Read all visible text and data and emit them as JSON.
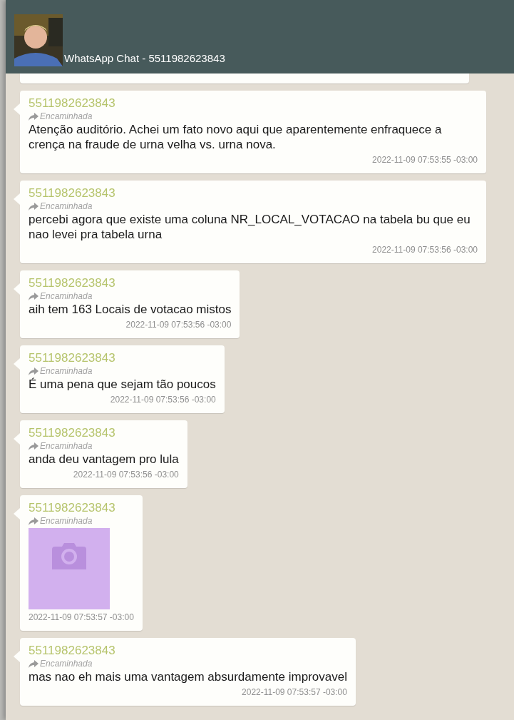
{
  "header": {
    "title": "WhatsApp Chat - 5511982623843"
  },
  "messages": [
    {
      "kind": "cut"
    },
    {
      "kind": "text",
      "sender": "5511982623843",
      "forwarded": true,
      "forward_label": "Encaminhada",
      "text": "Atenção auditório. Achei um fato novo aqui que aparentemente enfraquece a crença na fraude de urna velha vs. urna nova.",
      "time": "2022-11-09 07:53:55 -03:00"
    },
    {
      "kind": "text",
      "sender": "5511982623843",
      "forwarded": true,
      "forward_label": "Encaminhada",
      "text": "percebi agora que existe uma coluna NR_LOCAL_VOTACAO na tabela bu que eu nao levei pra tabela urna",
      "time": "2022-11-09 07:53:56 -03:00"
    },
    {
      "kind": "text",
      "sender": "5511982623843",
      "forwarded": true,
      "forward_label": "Encaminhada",
      "text": "aih tem 163 Locais de votacao mistos",
      "time": "2022-11-09 07:53:56 -03:00"
    },
    {
      "kind": "text",
      "sender": "5511982623843",
      "forwarded": true,
      "forward_label": "Encaminhada",
      "text": "É uma pena que sejam tão poucos",
      "time": "2022-11-09 07:53:56 -03:00"
    },
    {
      "kind": "text",
      "sender": "5511982623843",
      "forwarded": true,
      "forward_label": "Encaminhada",
      "text": "anda deu vantagem pro lula",
      "time": "2022-11-09 07:53:56 -03:00"
    },
    {
      "sender": "5511982623843",
      "forwarded": true,
      "forward_label": "Encaminhada",
      "time": "2022-11-09 07:53:57 -03:00"
    },
    {
      "kind": "text",
      "sender": "5511982623843",
      "forwarded": true,
      "forward_label": "Encaminhada",
      "text": "mas nao eh mais uma vantagem absurdamente improvavel",
      "time": "2022-11-09 07:53:57 -03:00"
    }
  ]
}
